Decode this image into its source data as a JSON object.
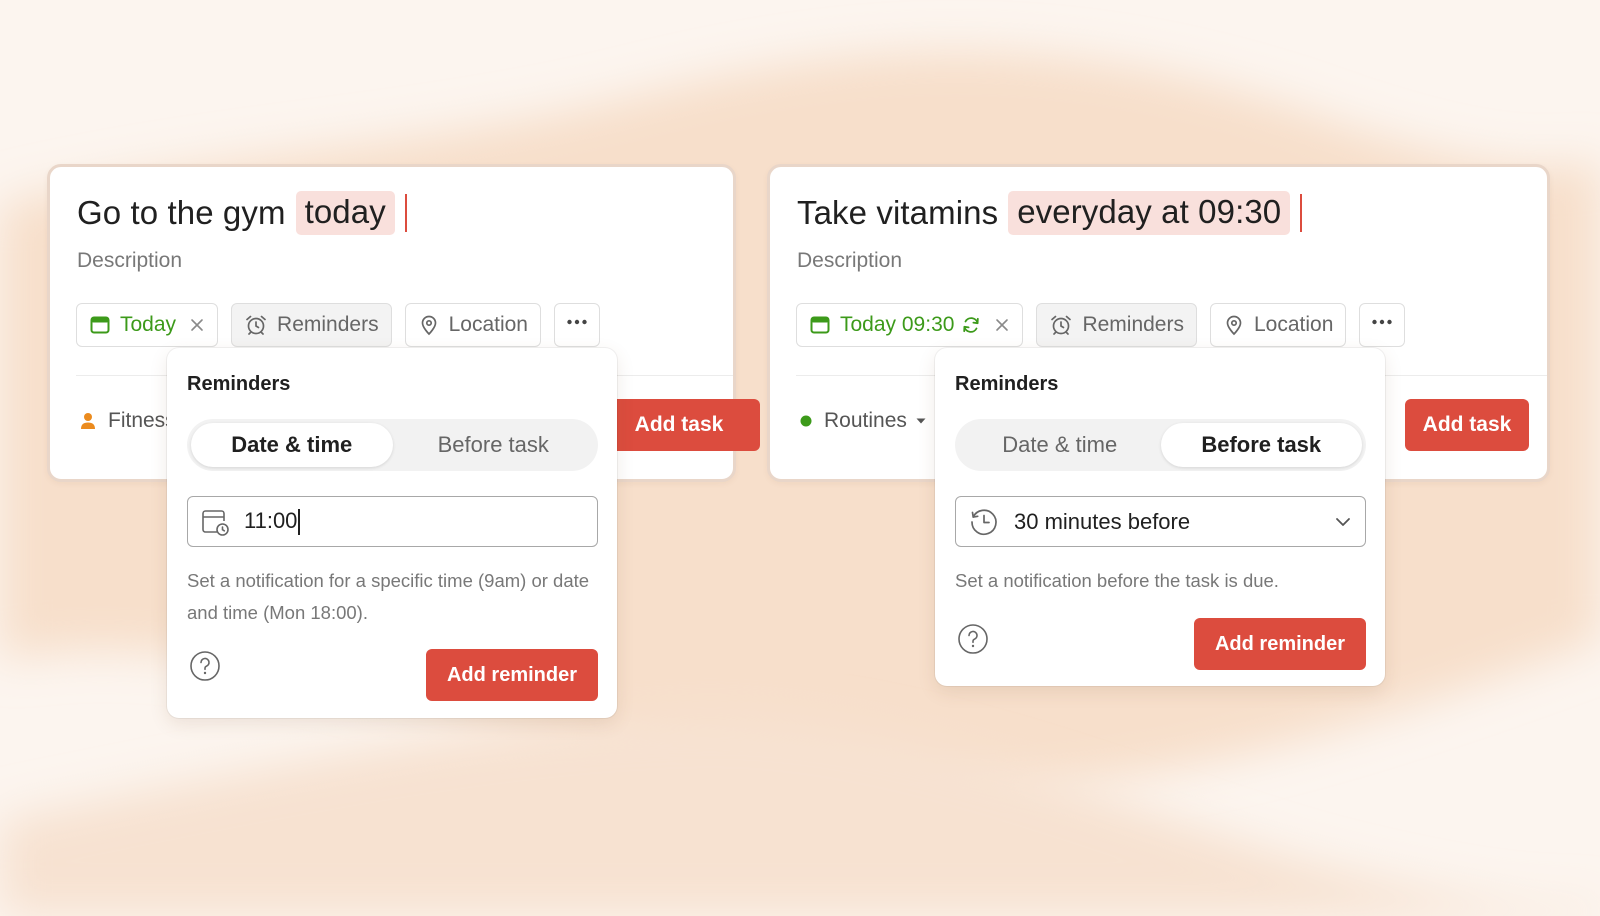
{
  "colors": {
    "accent": "#dc4c3e",
    "token_highlight": "#f9e0dc",
    "date_green": "#3c9a1a",
    "project_orange": "#eb8b1e",
    "project_green": "#3c9a1a",
    "background": "#fbf2ea"
  },
  "cards": [
    {
      "title": "Go to the gym",
      "title_token": "today",
      "description_placeholder": "Description",
      "chips": {
        "date": {
          "label": "Today",
          "icon": "calendar-icon"
        },
        "reminders": {
          "label": "Reminders",
          "icon": "alarm-clock-icon"
        },
        "location": {
          "label": "Location",
          "icon": "location-pin-icon"
        },
        "more": {
          "icon": "more-horizontal-icon"
        }
      },
      "project": {
        "label": "Fitness",
        "icon": "person-icon"
      },
      "add_task_label": "Add task",
      "popover": {
        "title": "Reminders",
        "tabs": [
          "Date & time",
          "Before task"
        ],
        "active_tab": "Date & time",
        "field_value": "11:00",
        "field_icon": "calendar-clock-icon",
        "help_text": "Set a notification for a specific time (9am) or date and time (Mon 18:00).",
        "add_label": "Add reminder",
        "help_icon": "question-circle-icon"
      }
    },
    {
      "title": "Take vitamins",
      "title_token": "everyday at 09:30",
      "description_placeholder": "Description",
      "chips": {
        "date": {
          "label": "Today 09:30",
          "icon": "calendar-icon",
          "recurring_icon": "recurring-icon"
        },
        "reminders": {
          "label": "Reminders",
          "icon": "alarm-clock-icon"
        },
        "location": {
          "label": "Location",
          "icon": "location-pin-icon"
        },
        "more": {
          "icon": "more-horizontal-icon"
        }
      },
      "project": {
        "label": "Routines",
        "icon": "dot-icon"
      },
      "add_task_label": "Add task",
      "popover": {
        "title": "Reminders",
        "tabs": [
          "Date & time",
          "Before task"
        ],
        "active_tab": "Before task",
        "field_value": "30 minutes before",
        "field_icon": "history-clock-icon",
        "help_text": "Set a notification before the task is due.",
        "add_label": "Add reminder",
        "help_icon": "question-circle-icon"
      }
    }
  ]
}
